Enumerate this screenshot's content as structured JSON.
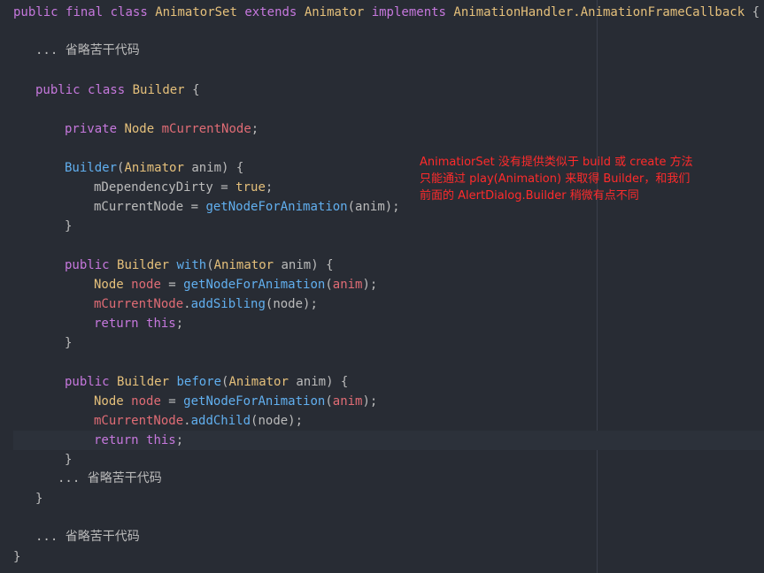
{
  "code": {
    "l1": {
      "public": "public",
      "final": "final",
      "class": "class",
      "name": "AnimatorSet",
      "extends": "extends",
      "parent": "Animator",
      "implements": "implements",
      "iface": "AnimationHandler.AnimationFrameCallback",
      "brace": "{"
    },
    "l2": {
      "dots": "...",
      "text": "省略苦干代码"
    },
    "l3": {
      "public": "public",
      "class": "class",
      "name": "Builder",
      "brace": "{"
    },
    "l4": {
      "private": "private",
      "type": "Node",
      "field": "mCurrentNode",
      "semi": ";"
    },
    "l5": {
      "ctor": "Builder",
      "open": "(",
      "ptype": "Animator",
      "rest": " anim) {"
    },
    "l6": {
      "field": "mDependencyDirty",
      "eq": " = ",
      "val": "true",
      "semi": ";"
    },
    "l7": {
      "field": "mCurrentNode",
      "eq": " = ",
      "call": "getNodeForAnimation",
      "args": "(anim);"
    },
    "l8": {
      "brace": "}"
    },
    "l9": {
      "public": "public",
      "type": "Builder",
      "method": "with",
      "open": "(",
      "ptype": "Animator",
      "rest": " anim) {"
    },
    "l10": {
      "type": "Node",
      "var": "node",
      "eq": " = ",
      "call": "getNodeForAnimation",
      "open": "(",
      "arg": "anim",
      "close": ");"
    },
    "l11": {
      "field": "mCurrentNode",
      "dot": ".",
      "call": "addSibling",
      "args": "(node);"
    },
    "l12": {
      "ret": "return",
      "this": "this",
      "semi": ";"
    },
    "l13": {
      "brace": "}"
    },
    "l14": {
      "public": "public",
      "type": "Builder",
      "method": "before",
      "open": "(",
      "ptype": "Animator",
      "rest": " anim) {"
    },
    "l15": {
      "type": "Node",
      "var": "node",
      "eq": " = ",
      "call": "getNodeForAnimation",
      "open": "(",
      "arg": "anim",
      "close": ");"
    },
    "l16": {
      "field": "mCurrentNode",
      "dot": ".",
      "call": "addChild",
      "args": "(node);"
    },
    "l17": {
      "ret": "return",
      "this": "this",
      "semi": ";"
    },
    "l18": {
      "brace": "}"
    },
    "l19": {
      "dots": "...",
      "text": "省略苦干代码"
    },
    "l20": {
      "brace": "}"
    },
    "l21": {
      "dots": "...",
      "text": "省略苦干代码"
    },
    "l22": {
      "brace": "}"
    }
  },
  "annotation": {
    "line1": "AnimatiorSet 没有提供类似于 build 或 create 方法",
    "line2": "只能通过 play(Animation) 来取得 Builder，和我们",
    "line3": "前面的 AlertDialog.Builder 稍微有点不同",
    "color": "#ff2b2b"
  },
  "colors": {
    "background": "#282c34",
    "keyword": "#c678dd",
    "type": "#e5c07b",
    "function": "#61afef",
    "field": "#e06c75",
    "plain": "#bbbbbb"
  }
}
